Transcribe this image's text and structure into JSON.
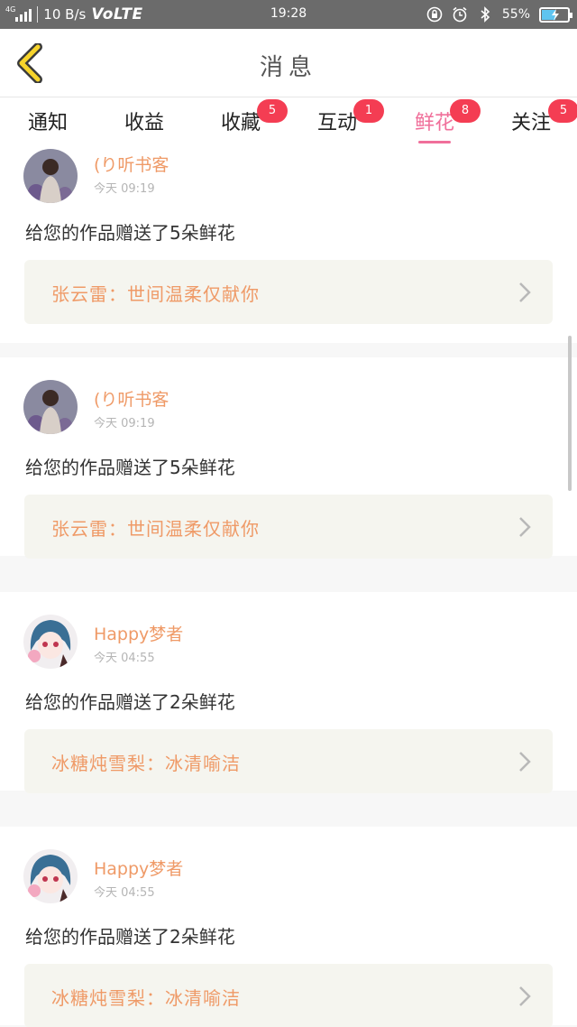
{
  "status_bar": {
    "network_type": "4G",
    "speed": "10 B/s",
    "volte": "VoLTE",
    "time": "19:28",
    "battery_percent_label": "55%",
    "battery_level": 0.55,
    "icons": [
      "signal-icon",
      "lock-rotate-icon",
      "alarm-icon",
      "bluetooth-icon",
      "battery-icon"
    ]
  },
  "header": {
    "title": "消息",
    "back_icon": "chevron-left-icon",
    "accent_color": "#f7d42b"
  },
  "tabs": [
    {
      "label": "通知",
      "badge": ""
    },
    {
      "label": "收益",
      "badge": ""
    },
    {
      "label": "收藏",
      "badge": "5"
    },
    {
      "label": "互动",
      "badge": "1"
    },
    {
      "label": "鲜花",
      "badge": "8",
      "active": true
    },
    {
      "label": "关注",
      "badge": "5"
    }
  ],
  "colors": {
    "active_tab": "#f06f9a",
    "badge": "#f43d53",
    "name": "#ef9a67",
    "reference_bg": "#f5f5ef"
  },
  "messages": [
    {
      "name": "(り听书客",
      "time": "今天 09:19",
      "text": "给您的作品赠送了5朵鲜花",
      "reference": "张云雷：世间温柔仅献你",
      "avatar": "avatar-girl-flowers"
    },
    {
      "name": "(り听书客",
      "time": "今天 09:19",
      "text": "给您的作品赠送了5朵鲜花",
      "reference": "张云雷：世间温柔仅献你",
      "avatar": "avatar-girl-flowers"
    },
    {
      "name": "Happy梦者",
      "time": "今天 04:55",
      "text": "给您的作品赠送了2朵鲜花",
      "reference": "冰糖炖雪梨：冰清喻洁",
      "avatar": "avatar-anime-girl"
    },
    {
      "name": "Happy梦者",
      "time": "今天 04:55",
      "text": "给您的作品赠送了2朵鲜花",
      "reference": "冰糖炖雪梨：冰清喻洁",
      "avatar": "avatar-anime-girl"
    }
  ]
}
